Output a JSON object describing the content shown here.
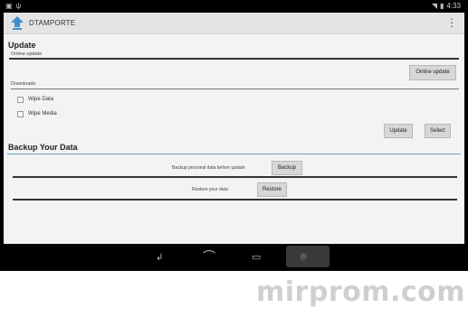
{
  "status_bar": {
    "left_icons": [
      "notification-icon",
      "usb-icon"
    ],
    "clock": "4:33"
  },
  "action_bar": {
    "title": "DTAMPORTE",
    "overflow_icon": "overflow-menu-icon"
  },
  "update_section": {
    "title": "Update",
    "online_label": "Online update",
    "online_button": "Online update",
    "download_label": "Downloads",
    "checkboxes": [
      {
        "label": "Wipe Data",
        "checked": false
      },
      {
        "label": "Wipe Media",
        "checked": false
      }
    ],
    "update_button": "Update",
    "select_button": "Select"
  },
  "backup_section": {
    "title": "Backup Your Data",
    "backup_text": "Backup personal data before update",
    "backup_button": "Backup",
    "restore_text": "Restore your data",
    "restore_button": "Restore"
  },
  "nav_bar": {
    "items": [
      "back-icon",
      "home-icon",
      "recents-icon",
      "screenshot-icon"
    ]
  },
  "watermark": "mirprom.com"
}
